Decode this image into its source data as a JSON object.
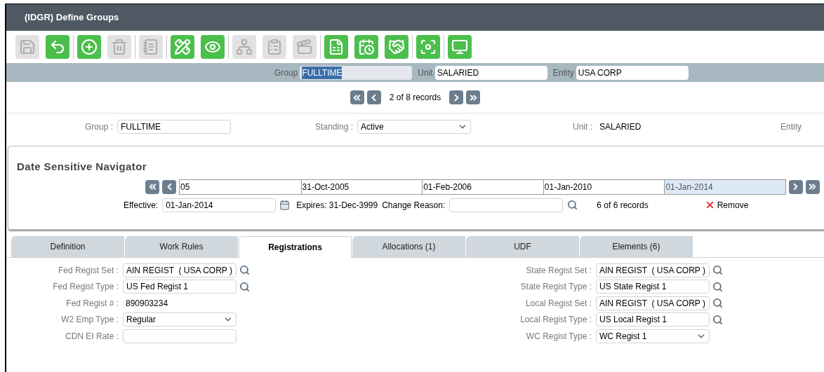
{
  "window": {
    "title": "(IDGR) Define Groups"
  },
  "toolbar": [
    [
      {
        "kind": "save",
        "enabled": false
      },
      {
        "kind": "undo",
        "enabled": true
      }
    ],
    [
      {
        "kind": "add",
        "enabled": true
      },
      {
        "kind": "delete",
        "enabled": false
      }
    ],
    [
      {
        "kind": "notes",
        "enabled": false
      }
    ],
    [
      {
        "kind": "edit",
        "enabled": true
      },
      {
        "kind": "view",
        "enabled": true
      }
    ],
    [
      {
        "kind": "hierarchy",
        "enabled": false
      },
      {
        "kind": "clipboard",
        "enabled": false
      },
      {
        "kind": "video",
        "enabled": false
      }
    ],
    [
      {
        "kind": "report",
        "enabled": true
      },
      {
        "kind": "calendar",
        "enabled": true
      },
      {
        "kind": "handshake",
        "enabled": true
      }
    ],
    [
      {
        "kind": "focus",
        "enabled": true
      }
    ],
    [
      {
        "kind": "monitor",
        "enabled": true
      }
    ]
  ],
  "header": [
    {
      "label": "Group",
      "value": "FULLTIME",
      "highlighted": true
    },
    {
      "label": "Unit",
      "value": "SALARIED",
      "highlighted": false
    },
    {
      "label": "Entity",
      "value": "USA CORP",
      "highlighted": false
    }
  ],
  "record_nav": {
    "text": "2 of 8 records"
  },
  "form": {
    "group": {
      "label": "Group :",
      "value": "FULLTIME"
    },
    "standing": {
      "label": "Standing :",
      "value": "Active"
    },
    "unit": {
      "label": "Unit :",
      "value": "SALARIED"
    },
    "entity": {
      "label": "Entity"
    }
  },
  "date_navigator": {
    "title": "Date Sensitive Navigator",
    "dates": [
      {
        "value": "05",
        "selected": false
      },
      {
        "value": "31-Oct-2005",
        "selected": false
      },
      {
        "value": "01-Feb-2006",
        "selected": false
      },
      {
        "value": "01-Jan-2010",
        "selected": false
      },
      {
        "value": "01-Jan-2014",
        "selected": true
      }
    ],
    "effective": {
      "label": "Effective:",
      "value": "01-Jan-2014"
    },
    "expires": "Expires: 31-Dec-3999",
    "change_reason": {
      "label": "Change Reason:"
    },
    "records": "6 of 6 records",
    "remove": "Remove"
  },
  "tabs": [
    {
      "label": "Definition",
      "selected": false
    },
    {
      "label": "Work Rules",
      "selected": false
    },
    {
      "label": "Registrations",
      "selected": true
    },
    {
      "label": "Allocations  (1)",
      "selected": false
    },
    {
      "label": "UDF",
      "selected": false
    },
    {
      "label": "Elements  (6)",
      "selected": false
    }
  ],
  "fields_left": [
    {
      "label": "Fed Regist Set :",
      "value": "AIN REGIST  ( USA CORP )",
      "kind": "lookup"
    },
    {
      "label": "Fed Regist Type :",
      "value": "US Fed Regist 1",
      "kind": "lookup"
    },
    {
      "label": "Fed Regist # :",
      "value": "890903234",
      "kind": "text"
    },
    {
      "label": "W2 Emp Type :",
      "value": "Regular",
      "kind": "select"
    },
    {
      "label": "CDN EI Rate :",
      "kind": "input"
    }
  ],
  "fields_right": [
    {
      "label": "State Regist Set :",
      "value": "AIN REGIST  ( USA CORP )",
      "kind": "lookup"
    },
    {
      "label": "State Regist Type :",
      "value": "US State Regist 1",
      "kind": "lookup"
    },
    {
      "label": "Local Regist Set :",
      "value": "AIN REGIST  ( USA CORP )",
      "kind": "lookup"
    },
    {
      "label": "Local Regist Type :",
      "value": "US Local Regist 1",
      "kind": "lookup"
    },
    {
      "label": "WC Regist Type :",
      "value": "WC Regist 1",
      "kind": "select"
    }
  ]
}
